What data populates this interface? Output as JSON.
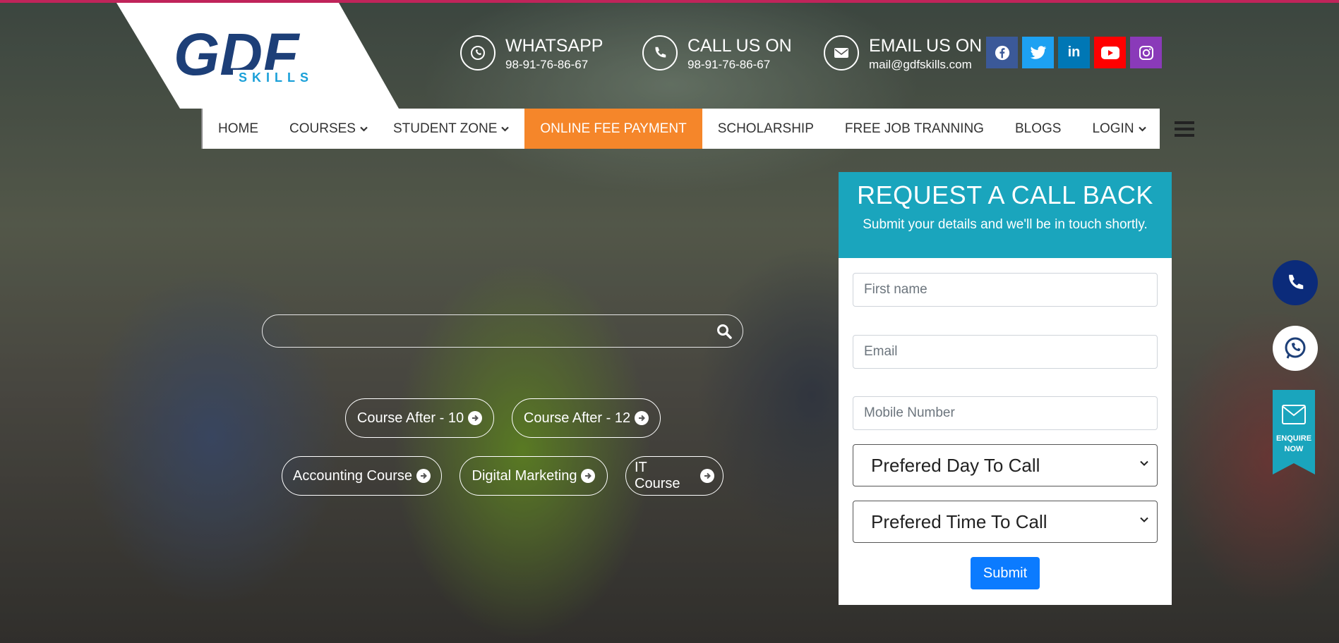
{
  "brand": {
    "logo_main": "GDF",
    "logo_sub": "SKILLS"
  },
  "contacts": [
    {
      "title": "WHATSAPP",
      "value": "98-91-76-86-67",
      "icon": "whatsapp-icon"
    },
    {
      "title": "CALL US ON",
      "value": "98-91-76-86-67",
      "icon": "phone-icon"
    },
    {
      "title": "EMAIL US ON",
      "value": "mail@gdfskills.com",
      "icon": "envelope-icon"
    }
  ],
  "socials": [
    {
      "name": "facebook",
      "glyph": "f",
      "color": "#3b5998"
    },
    {
      "name": "twitter",
      "glyph": "t",
      "color": "#1da1f2"
    },
    {
      "name": "linkedin",
      "glyph": "in",
      "color": "#0077b5"
    },
    {
      "name": "youtube",
      "glyph": "▶",
      "color": "#ff0000"
    },
    {
      "name": "instagram",
      "glyph": "◎",
      "color": "#8a3ab9"
    }
  ],
  "nav": {
    "home": "HOME",
    "courses": "COURSES",
    "student_zone": "STUDENT ZONE",
    "online_fee": "ONLINE FEE PAYMENT",
    "scholarship": "SCHOLARSHIP",
    "free_job": "FREE JOB TRANNING",
    "blogs": "BLOGS",
    "login": "LOGIN"
  },
  "search": {
    "placeholder": ""
  },
  "quick_links": [
    "Course After - 10",
    "Course After - 12",
    "Accounting Course",
    "Digital Marketing",
    "IT Course"
  ],
  "form": {
    "title": "REQUEST A CALL BACK",
    "subtitle": "Submit your details and we'll be in touch shortly.",
    "first_name_placeholder": "First name",
    "email_placeholder": "Email",
    "mobile_placeholder": "Mobile Number",
    "day_select": "Prefered Day To Call",
    "time_select": "Prefered Time To Call",
    "submit": "Submit"
  },
  "enquire": {
    "line1": "ENQUIRE",
    "line2": "NOW"
  },
  "colors": {
    "accent_orange": "#f5862a",
    "form_header": "#1aa5bd",
    "submit_blue": "#0b7bff",
    "logo_blue": "#1d3f78"
  }
}
